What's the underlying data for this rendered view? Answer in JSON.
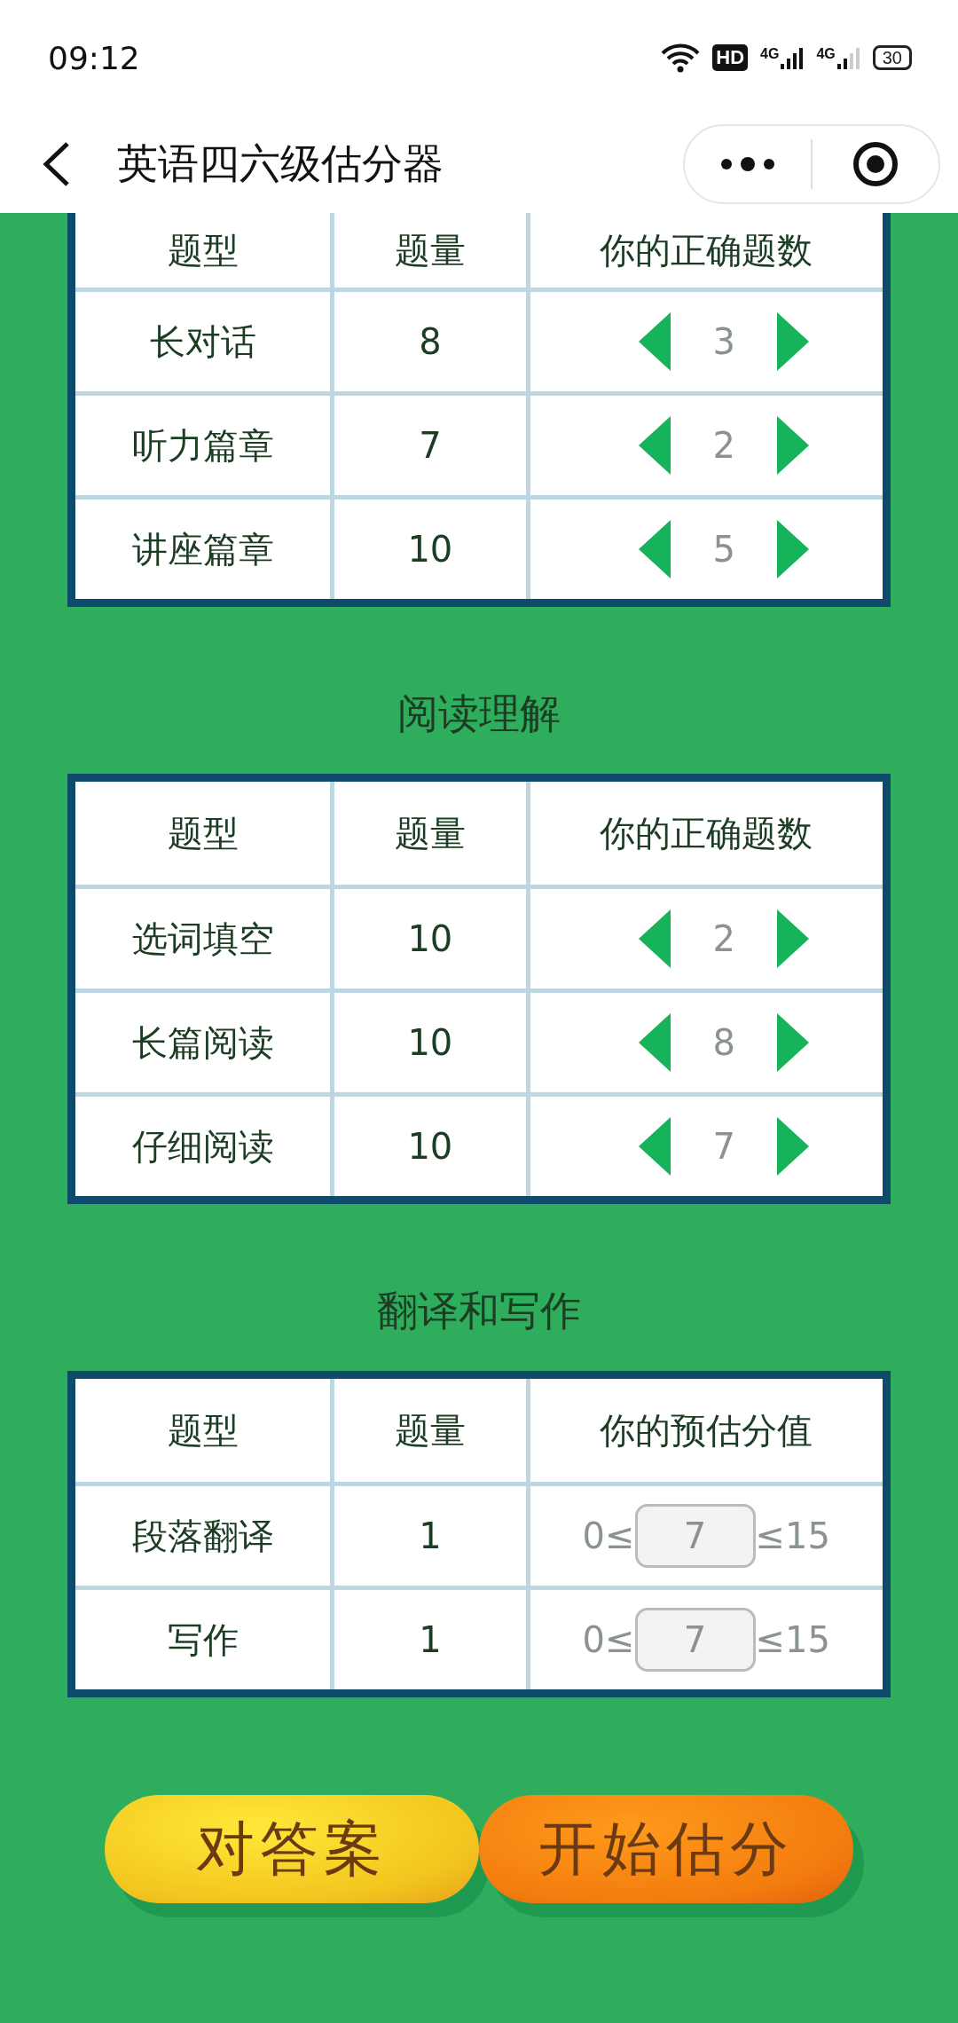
{
  "status_bar": {
    "time": "09:12",
    "hd": "HD",
    "network_1": "4G",
    "network_2": "4G",
    "battery": "30"
  },
  "nav_bar": {
    "title": "英语四六级估分器"
  },
  "sections": [
    {
      "columns": [
        "题型",
        "题量",
        "你的正确题数"
      ],
      "rows": [
        {
          "kind": "stepper",
          "type": "长对话",
          "count": "8",
          "value": "3"
        },
        {
          "kind": "stepper",
          "type": "听力篇章",
          "count": "7",
          "value": "2"
        },
        {
          "kind": "stepper",
          "type": "讲座篇章",
          "count": "10",
          "value": "5"
        }
      ]
    },
    {
      "title": "阅读理解",
      "columns": [
        "题型",
        "题量",
        "你的正确题数"
      ],
      "rows": [
        {
          "kind": "stepper",
          "type": "选词填空",
          "count": "10",
          "value": "2"
        },
        {
          "kind": "stepper",
          "type": "长篇阅读",
          "count": "10",
          "value": "8"
        },
        {
          "kind": "stepper",
          "type": "仔细阅读",
          "count": "10",
          "value": "7"
        }
      ]
    },
    {
      "title": "翻译和写作",
      "columns": [
        "题型",
        "题量",
        "你的预估分值"
      ],
      "rows": [
        {
          "kind": "input",
          "type": "段落翻译",
          "count": "1",
          "min": "0≤",
          "value": "7",
          "max": "≤15"
        },
        {
          "kind": "input",
          "type": "写作",
          "count": "1",
          "min": "0≤",
          "value": "7",
          "max": "≤15"
        }
      ]
    }
  ],
  "buttons": [
    {
      "label": "对答案",
      "kind": "yellow"
    },
    {
      "label": "开始估分",
      "kind": "orange"
    }
  ]
}
